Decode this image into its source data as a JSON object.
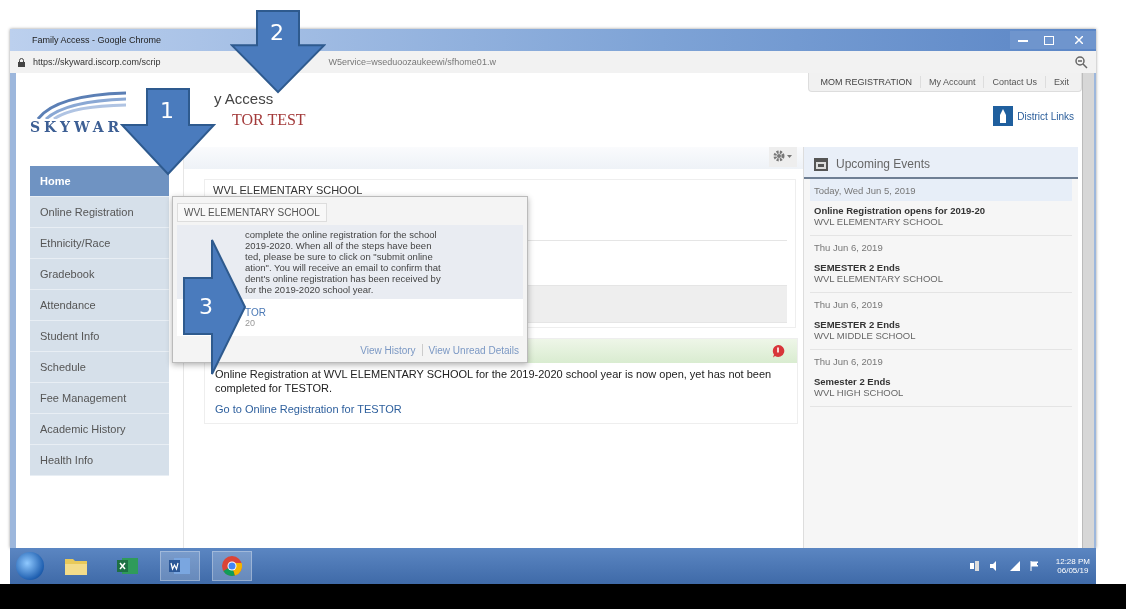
{
  "window": {
    "title": "Family Access - Google Chrome"
  },
  "address_bar": {
    "url_parts": [
      "https://skyward.iscorp.com/scrip",
      "W5ervice=wseduoozaukeewi/sfhome01.w"
    ]
  },
  "header": {
    "logo_text": "SKYWAR",
    "title_fragment": "y Access",
    "student_fragment": "TOR TEST",
    "top_links": [
      "MOM REGISTRATION",
      "My Account",
      "Contact Us",
      "Exit"
    ],
    "district_links": "District Links"
  },
  "sidebar": {
    "items": [
      {
        "label": "Home",
        "selected": true
      },
      {
        "label": "Online Registration",
        "selected": false
      },
      {
        "label": "Ethnicity/Race",
        "selected": false
      },
      {
        "label": "Gradebook",
        "selected": false
      },
      {
        "label": "Attendance",
        "selected": false
      },
      {
        "label": "Student Info",
        "selected": false
      },
      {
        "label": "Schedule",
        "selected": false
      },
      {
        "label": "Fee Management",
        "selected": false
      },
      {
        "label": "Academic History",
        "selected": false
      },
      {
        "label": "Health Info",
        "selected": false
      }
    ]
  },
  "main": {
    "school_heading": "WVL ELEMENTARY SCHOOL",
    "alert": true,
    "message": "Online Registration at WVL ELEMENTARY SCHOOL for the 2019-2020 school year is now open, yet has not been completed for TESTOR.",
    "link": "Go to Online Registration for TESTOR"
  },
  "popup": {
    "tab": "WVL ELEMENTARY SCHOOL",
    "lines": [
      "complete the online registration for the school",
      "2019-2020. When all of the steps have been",
      "ted, please be sure to click on \"submit online",
      "ation\". You will receive an email to confirm that",
      "dent's online registration has been received by",
      "for the 2019-2020 school year."
    ],
    "student": "TOR",
    "year": "20",
    "links": [
      "View History",
      "View Unread Details"
    ]
  },
  "events": {
    "title": "Upcoming Events",
    "days": [
      {
        "date": "Today, Wed Jun 5, 2019",
        "today": true,
        "title": "Online Registration opens for 2019-20",
        "school": "WVL ELEMENTARY SCHOOL"
      },
      {
        "date": "Thu Jun 6, 2019",
        "today": false,
        "title": "SEMESTER 2 Ends",
        "school": "WVL ELEMENTARY SCHOOL"
      },
      {
        "date": "Thu Jun 6, 2019",
        "today": false,
        "title": "SEMESTER 2 Ends",
        "school": "WVL MIDDLE SCHOOL"
      },
      {
        "date": "Thu Jun 6, 2019",
        "today": false,
        "title": "Semester 2 Ends",
        "school": "WVL HIGH SCHOOL"
      }
    ]
  },
  "callouts": [
    {
      "number": "1",
      "kind": "down"
    },
    {
      "number": "2",
      "kind": "down"
    },
    {
      "number": "3",
      "kind": "right"
    }
  ],
  "taskbar": {
    "time": "12:28 PM",
    "date": "06/05/19"
  }
}
